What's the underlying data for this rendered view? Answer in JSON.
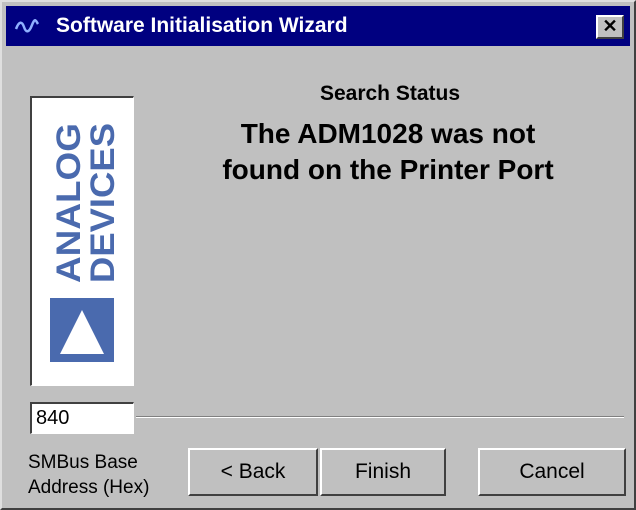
{
  "window": {
    "title": "Software Initialisation Wizard",
    "close_glyph": "✕",
    "icons": [
      "waveform-icon",
      "close-icon"
    ]
  },
  "logo": {
    "line1": "ANALOG",
    "line2": "DEVICES",
    "color": "#4a6aae"
  },
  "status": {
    "heading": "Search Status",
    "message_line1": "The ADM1028 was not",
    "message_line2": "found on the Printer Port"
  },
  "address": {
    "value": "840",
    "label_line1": "SMBus Base",
    "label_line2": "Address (Hex)"
  },
  "buttons": {
    "back": "< Back",
    "finish": "Finish",
    "cancel": "Cancel"
  },
  "colors": {
    "titlebar": "#000080",
    "face": "#c0c0c0"
  }
}
